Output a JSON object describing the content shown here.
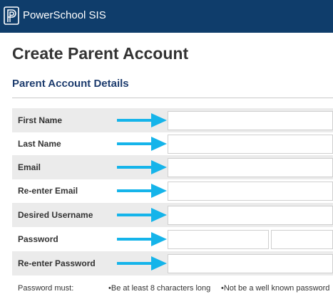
{
  "header": {
    "brand": "PowerSchool SIS",
    "logo_icon": "powerschool-p-logo",
    "background": "#0f3d6b"
  },
  "page": {
    "title": "Create Parent Account",
    "section_title": "Parent Account Details"
  },
  "form": {
    "first_name_label": "First Name",
    "last_name_label": "Last Name",
    "email_label": "Email",
    "reenter_email_label": "Re-enter Email",
    "username_label": "Desired Username",
    "password_label": "Password",
    "reenter_password_label": "Re-enter Password",
    "first_name_value": "",
    "last_name_value": "",
    "email_value": "",
    "reenter_email_value": "",
    "username_value": "",
    "password_value": "",
    "reenter_password_value": ""
  },
  "password_rules": {
    "lead": "Password must:",
    "rule_1": "•Be at least 8 characters long",
    "rule_2": "•Not be a well known password"
  },
  "annotation": {
    "arrow_icon": "right-arrow-icon",
    "arrow_color": "#15b4ea"
  }
}
